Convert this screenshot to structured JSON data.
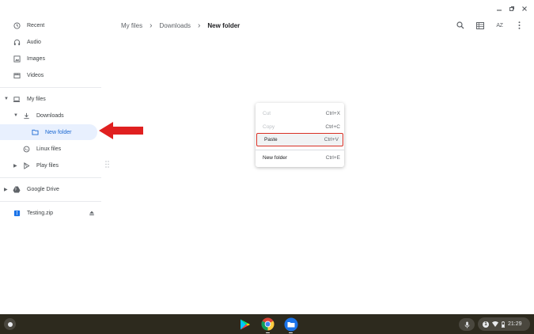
{
  "window": {
    "icons": [
      "minimize-icon",
      "maximize-icon",
      "close-icon"
    ]
  },
  "sidebar": {
    "recent": "Recent",
    "audio": "Audio",
    "images": "Images",
    "videos": "Videos",
    "my_files": "My files",
    "downloads": "Downloads",
    "new_folder": "New folder",
    "linux_files": "Linux files",
    "play_files": "Play files",
    "google_drive": "Google Drive",
    "testing_zip": "Testing.zip"
  },
  "breadcrumb": {
    "root": "My files",
    "middle": "Downloads",
    "current": "New folder"
  },
  "toolbar": {
    "sort_label": "AZ",
    "icons": [
      "search-icon",
      "grid-view-icon",
      "sort-icon",
      "more-vert-icon"
    ]
  },
  "context_menu": {
    "items": [
      {
        "label": "Cut",
        "shortcut": "Ctrl+X",
        "enabled": false
      },
      {
        "label": "Copy",
        "shortcut": "Ctrl+C",
        "enabled": false
      },
      {
        "label": "Paste",
        "shortcut": "Ctrl+V",
        "enabled": true,
        "highlighted": true
      },
      {
        "label": "New folder",
        "shortcut": "Ctrl+E",
        "enabled": true
      }
    ]
  },
  "shelf": {
    "apps": [
      "play-store-icon",
      "chrome-icon",
      "files-app-icon"
    ],
    "notification_count": "1",
    "time": "21:29"
  },
  "colors": {
    "selected_bg": "#e8f0fe",
    "selected_text": "#1967d2",
    "annotation_red": "#e02020",
    "shelf_bg": "#2d2a1e"
  }
}
